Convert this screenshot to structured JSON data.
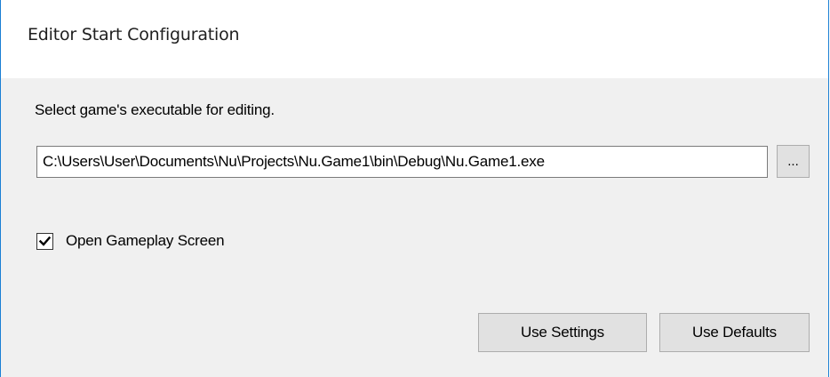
{
  "window": {
    "title": "Editor Start Configuration"
  },
  "form": {
    "prompt": "Select game's executable for editing.",
    "path_value": "C:\\Users\\User\\Documents\\Nu\\Projects\\Nu.Game1\\bin\\Debug\\Nu.Game1.exe",
    "browse_label": "...",
    "checkbox_label": "Open Gameplay Screen",
    "checkbox_checked": true
  },
  "buttons": {
    "use_settings": "Use Settings",
    "use_defaults": "Use Defaults"
  },
  "colors": {
    "window_border": "#1a7fd4",
    "title_bg": "#ffffff",
    "client_bg": "#f0f0f0",
    "button_bg": "#e1e1e1"
  }
}
